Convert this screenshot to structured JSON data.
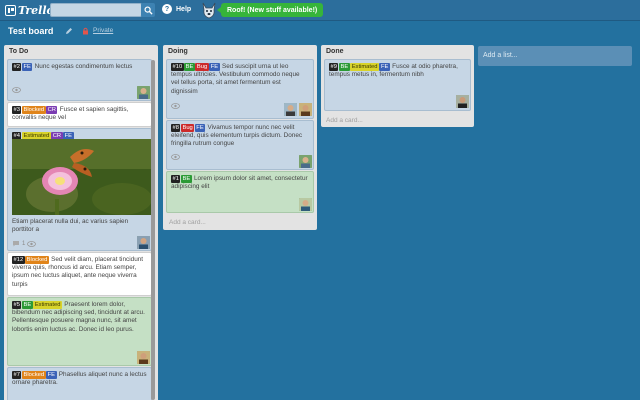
{
  "header": {
    "logo_text": "Trello",
    "search_value": "",
    "help_label": "Help",
    "notification_label": "Roof! (New stuff available!)"
  },
  "board": {
    "title": "Test board",
    "privacy": "Private"
  },
  "lists": {
    "todo": {
      "title": "To Do",
      "cards": [
        {
          "num": "#2",
          "labels": [
            "FE"
          ],
          "text": "Nunc egestas condimentum lectus"
        },
        {
          "num": "#3",
          "labels": [
            "Blocked",
            "CR"
          ],
          "text": "Fusce et sapien sagittis, convallis neque vel"
        },
        {
          "num": "#4",
          "labels": [
            "Estimated",
            "CR",
            "FE"
          ],
          "text": "Etiam placerat nulla dui, ac varius sapien porttitor a",
          "badge_count": "1"
        },
        {
          "num": "#12",
          "labels": [
            "Blocked"
          ],
          "text": "Sed velit diam, placerat tincidunt viverra quis, rhoncus id arcu. Etiam semper, ipsum nec luctus aliquet, ante neque viverra turpis"
        },
        {
          "num": "#5",
          "labels": [
            "BE",
            "Estimated"
          ],
          "text": "Praesent lorem dolor, bibendum nec adipiscing sed, tincidunt at arcu. Pellentesque posuere magna nunc, sit amet lobortis enim luctus ac. Donec id leo purus."
        },
        {
          "num": "#7",
          "labels": [
            "Blocked",
            "FE"
          ],
          "text": "Phasellus aliquet nunc a lectus ornare pharetra."
        }
      ]
    },
    "doing": {
      "title": "Doing",
      "cards": [
        {
          "num": "#10",
          "labels": [
            "BE",
            "Bug",
            "FE"
          ],
          "text": "Sed suscipit urna ut leo tempus ultricies. Vestibulum commodo neque vel tellus porta, sit amet fermentum est dignissim"
        },
        {
          "num": "#8",
          "labels": [
            "Bug",
            "FE"
          ],
          "text": "Vivamus tempor nunc nec velit eleifend, quis elementum turpis dictum. Donec fringilla rutrum congue"
        },
        {
          "num": "#1",
          "labels": [
            "BE"
          ],
          "text": "Lorem ipsum dolor sit amet, consectetur adipiscing elit"
        }
      ],
      "add_card": "Add a card..."
    },
    "done": {
      "title": "Done",
      "cards": [
        {
          "num": "#9",
          "labels": [
            "BE",
            "Estimated",
            "FE"
          ],
          "text": "Fusce at odio pharetra, tempus metus in, fermentum nibh"
        }
      ],
      "add_card": "Add a card..."
    }
  },
  "add_list": "Add a list...",
  "colors": {
    "background": "#23719f",
    "header": "#2c6e9c",
    "notification": "#36b43a",
    "list": "#e3e3e3"
  }
}
